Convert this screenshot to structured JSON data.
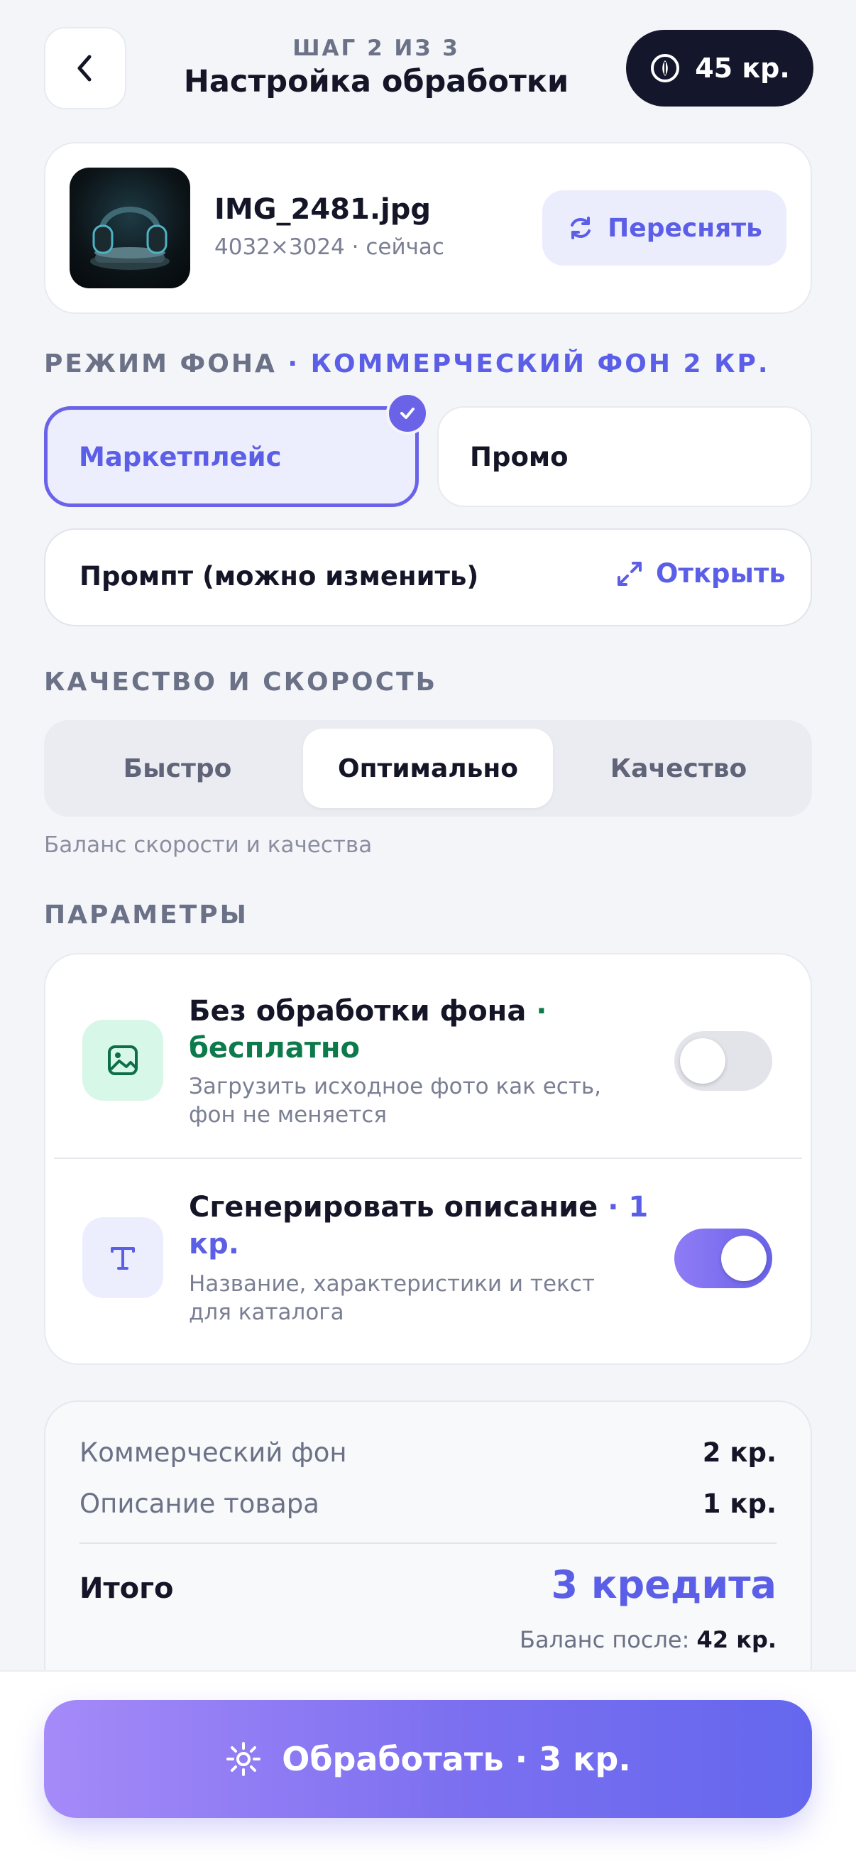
{
  "header": {
    "step": "ШАГ 2 ИЗ 3",
    "title": "Настройка обработки",
    "credits": "45 кр."
  },
  "file": {
    "name": "IMG_2481.jpg",
    "meta": "4032×3024 · сейчас",
    "reshoot_label": "Переснять"
  },
  "background_mode": {
    "heading": "РЕЖИМ ФОНА",
    "heading_accent": "· КОММЕРЧЕСКИЙ ФОН 2 КР.",
    "options": [
      "Маркетплейс",
      "Промо"
    ],
    "selected": "Маркетплейс",
    "prompt_label": "Промпт (можно изменить)",
    "open_label": "Открыть"
  },
  "quality": {
    "heading": "КАЧЕСТВО И СКОРОСТЬ",
    "options": [
      "Быстро",
      "Оптимально",
      "Качество"
    ],
    "selected": "Оптимально",
    "hint": "Баланс скорости и качества"
  },
  "params": {
    "heading": "ПАРАМЕТРЫ",
    "items": [
      {
        "title": "Без обработки фона",
        "badge": " · бесплатно",
        "desc": "Загрузить исходное фото как есть, фон не меняется",
        "enabled": false,
        "icon": "image-icon"
      },
      {
        "title": "Сгенерировать описание",
        "badge": " · 1 кр.",
        "desc": "Название, характеристики и текст для каталога",
        "enabled": true,
        "icon": "text-icon"
      }
    ]
  },
  "summary": {
    "rows": [
      {
        "label": "Коммерческий фон",
        "value": "2 кр."
      },
      {
        "label": "Описание товара",
        "value": "1 кр."
      }
    ],
    "total_label": "Итого",
    "total_value": "3 кредита",
    "balance_after_label": "Баланс после:",
    "balance_after_value": "42 кр."
  },
  "action": {
    "label": "Обработать · 3 кр."
  },
  "colors": {
    "accent": "#5b5ee6",
    "dark": "#14172b",
    "free_green": "#0d7a4b",
    "background": "#f4f5f9"
  }
}
